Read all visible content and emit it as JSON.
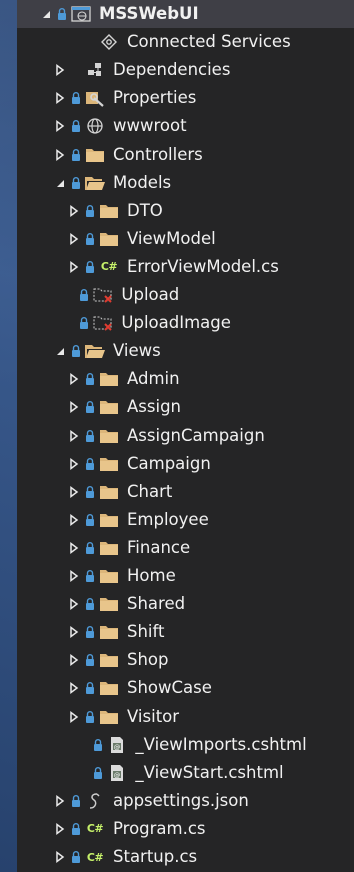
{
  "tree": {
    "items": [
      {
        "id": "mssweb",
        "label": "MSSWebUI",
        "indent": 1,
        "arrow": "expanded",
        "lock": true,
        "icon": "web-project-icon",
        "root": true
      },
      {
        "id": "connected-services",
        "label": "Connected Services",
        "indent": 3,
        "arrow": "none",
        "lock": false,
        "icon": "connected-services-icon"
      },
      {
        "id": "dependencies",
        "label": "Dependencies",
        "indent": 2,
        "arrow": "collapsed",
        "lock": false,
        "icon": "dependencies-icon"
      },
      {
        "id": "properties",
        "label": "Properties",
        "indent": 2,
        "arrow": "collapsed",
        "lock": true,
        "icon": "properties-icon"
      },
      {
        "id": "wwwroot",
        "label": "wwwroot",
        "indent": 2,
        "arrow": "collapsed",
        "lock": true,
        "icon": "globe-icon"
      },
      {
        "id": "controllers",
        "label": "Controllers",
        "indent": 2,
        "arrow": "collapsed",
        "lock": true,
        "icon": "folder-icon"
      },
      {
        "id": "models",
        "label": "Models",
        "indent": 2,
        "arrow": "expanded",
        "lock": true,
        "icon": "folder-open-icon"
      },
      {
        "id": "dto",
        "label": "DTO",
        "indent": 3,
        "arrow": "collapsed",
        "lock": true,
        "icon": "folder-icon"
      },
      {
        "id": "viewmodel",
        "label": "ViewModel",
        "indent": 3,
        "arrow": "collapsed",
        "lock": true,
        "icon": "folder-icon"
      },
      {
        "id": "errorviewmodel",
        "label": "ErrorViewModel.cs",
        "indent": 3,
        "arrow": "collapsed",
        "lock": true,
        "icon": "csharp-icon"
      },
      {
        "id": "upload",
        "label": "Upload",
        "indent": 2.6,
        "arrow": "none",
        "lock": true,
        "icon": "missing-folder-icon"
      },
      {
        "id": "uploadimage",
        "label": "UploadImage",
        "indent": 2.6,
        "arrow": "none",
        "lock": true,
        "icon": "missing-folder-icon"
      },
      {
        "id": "views",
        "label": "Views",
        "indent": 2,
        "arrow": "expanded",
        "lock": true,
        "icon": "folder-open-icon"
      },
      {
        "id": "admin",
        "label": "Admin",
        "indent": 3,
        "arrow": "collapsed",
        "lock": true,
        "icon": "folder-icon"
      },
      {
        "id": "assign",
        "label": "Assign",
        "indent": 3,
        "arrow": "collapsed",
        "lock": true,
        "icon": "folder-icon"
      },
      {
        "id": "assigncampaign",
        "label": "AssignCampaign",
        "indent": 3,
        "arrow": "collapsed",
        "lock": true,
        "icon": "folder-icon"
      },
      {
        "id": "campaign",
        "label": "Campaign",
        "indent": 3,
        "arrow": "collapsed",
        "lock": true,
        "icon": "folder-icon"
      },
      {
        "id": "chart",
        "label": "Chart",
        "indent": 3,
        "arrow": "collapsed",
        "lock": true,
        "icon": "folder-icon"
      },
      {
        "id": "employee",
        "label": "Employee",
        "indent": 3,
        "arrow": "collapsed",
        "lock": true,
        "icon": "folder-icon"
      },
      {
        "id": "finance",
        "label": "Finance",
        "indent": 3,
        "arrow": "collapsed",
        "lock": true,
        "icon": "folder-icon"
      },
      {
        "id": "home",
        "label": "Home",
        "indent": 3,
        "arrow": "collapsed",
        "lock": true,
        "icon": "folder-icon"
      },
      {
        "id": "shared",
        "label": "Shared",
        "indent": 3,
        "arrow": "collapsed",
        "lock": true,
        "icon": "folder-icon"
      },
      {
        "id": "shift",
        "label": "Shift",
        "indent": 3,
        "arrow": "collapsed",
        "lock": true,
        "icon": "folder-icon"
      },
      {
        "id": "shop",
        "label": "Shop",
        "indent": 3,
        "arrow": "collapsed",
        "lock": true,
        "icon": "folder-icon"
      },
      {
        "id": "showcase",
        "label": "ShowCase",
        "indent": 3,
        "arrow": "collapsed",
        "lock": true,
        "icon": "folder-icon"
      },
      {
        "id": "visitor",
        "label": "Visitor",
        "indent": 3,
        "arrow": "collapsed",
        "lock": true,
        "icon": "folder-icon"
      },
      {
        "id": "viewimports",
        "label": "_ViewImports.cshtml",
        "indent": 3.6,
        "arrow": "none",
        "lock": true,
        "icon": "razor-file-icon"
      },
      {
        "id": "viewstart",
        "label": "_ViewStart.cshtml",
        "indent": 3.6,
        "arrow": "none",
        "lock": true,
        "icon": "razor-file-icon"
      },
      {
        "id": "appsettings",
        "label": "appsettings.json",
        "indent": 2,
        "arrow": "collapsed",
        "lock": true,
        "icon": "json-file-icon"
      },
      {
        "id": "program",
        "label": "Program.cs",
        "indent": 2,
        "arrow": "collapsed",
        "lock": true,
        "icon": "csharp-icon"
      },
      {
        "id": "startup",
        "label": "Startup.cs",
        "indent": 2,
        "arrow": "collapsed",
        "lock": true,
        "icon": "csharp-icon"
      }
    ]
  },
  "colors": {
    "panel_bg": "#252526",
    "selected_bg": "#3f3f46",
    "text": "#f1f1f1",
    "folder": "#dcb67a",
    "lock": "#4e9ad8",
    "csharp": "#c6f16a",
    "missing": "#e03c31",
    "globe": "#d4d4d4"
  }
}
